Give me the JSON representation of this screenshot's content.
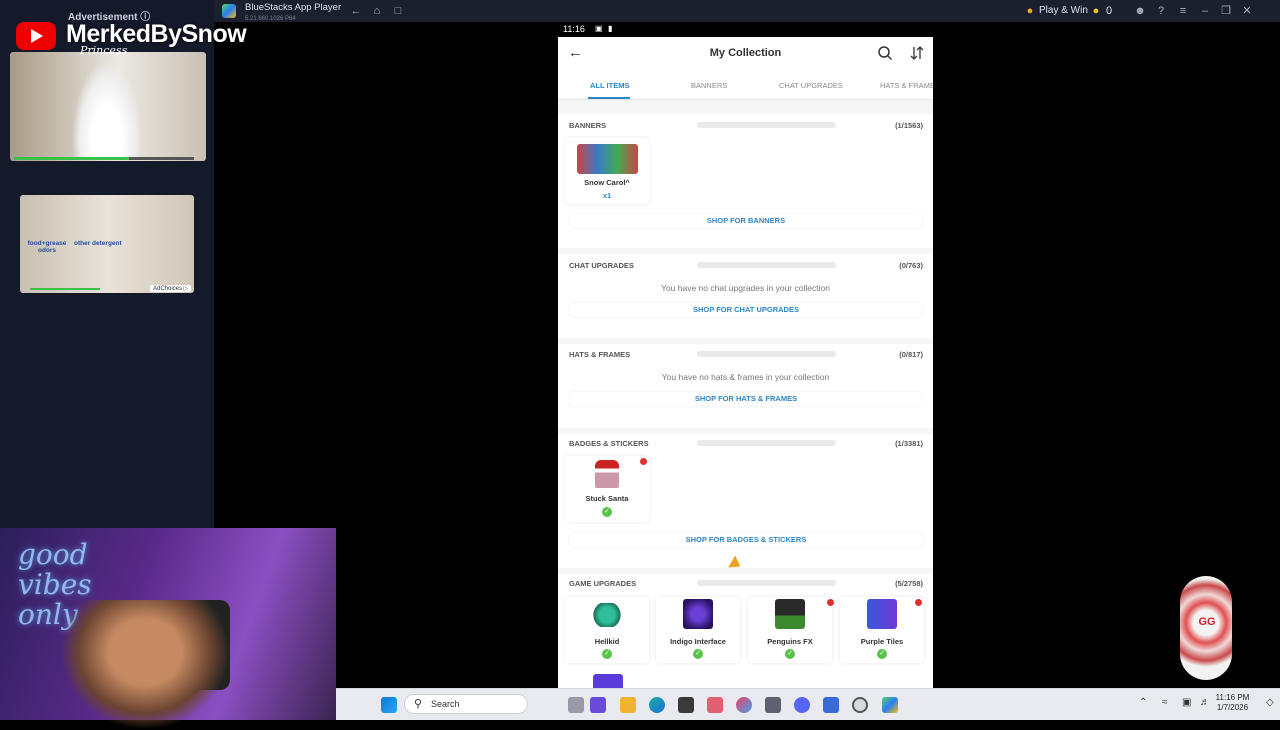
{
  "window": {
    "app_title": "BlueStacks App Player",
    "app_subtitle": "5.21.660.1026 P64",
    "play_win": "Play & Win",
    "coins": "0"
  },
  "left": {
    "ad_header": "Advertisement ⓘ",
    "channel": "MerkedBySnow",
    "ad1_text": "Princess",
    "ad2_text1": "food+grease odors",
    "ad2_text2": "other detergent",
    "adchoices": "AdChoices ▷",
    "neon": "good vibes only"
  },
  "phone": {
    "status_time": "11:16",
    "title": "My Collection",
    "tabs": [
      "ALL ITEMS",
      "BANNERS",
      "CHAT UPGRADES",
      "HATS & FRAMES"
    ],
    "sections": [
      {
        "title": "BANNERS",
        "count": "(1/1563)",
        "items": [
          {
            "name": "Snow Carol^",
            "qty": "x1"
          }
        ],
        "shop": "SHOP FOR BANNERS"
      },
      {
        "title": "CHAT UPGRADES",
        "count": "(0/763)",
        "empty": "You have no chat upgrades in your collection",
        "shop": "SHOP FOR CHAT UPGRADES"
      },
      {
        "title": "HATS & FRAMES",
        "count": "(0/817)",
        "empty": "You have no hats & frames in your collection",
        "shop": "SHOP FOR HATS & FRAMES"
      },
      {
        "title": "BADGES & STICKERS",
        "count": "(1/3381)",
        "items": [
          {
            "name": "Stuck Santa"
          }
        ],
        "shop": "SHOP FOR BADGES & STICKERS"
      },
      {
        "title": "GAME UPGRADES",
        "count": "(5/2758)",
        "items": [
          {
            "name": "Hellkid"
          },
          {
            "name": "Indigo Interface"
          },
          {
            "name": "Penguins FX"
          },
          {
            "name": "Purple Tiles"
          }
        ]
      }
    ]
  },
  "taskbar": {
    "search": "Search",
    "time": "11:16 PM",
    "date": "1/7/2026"
  },
  "chip": {
    "text": "GG"
  }
}
